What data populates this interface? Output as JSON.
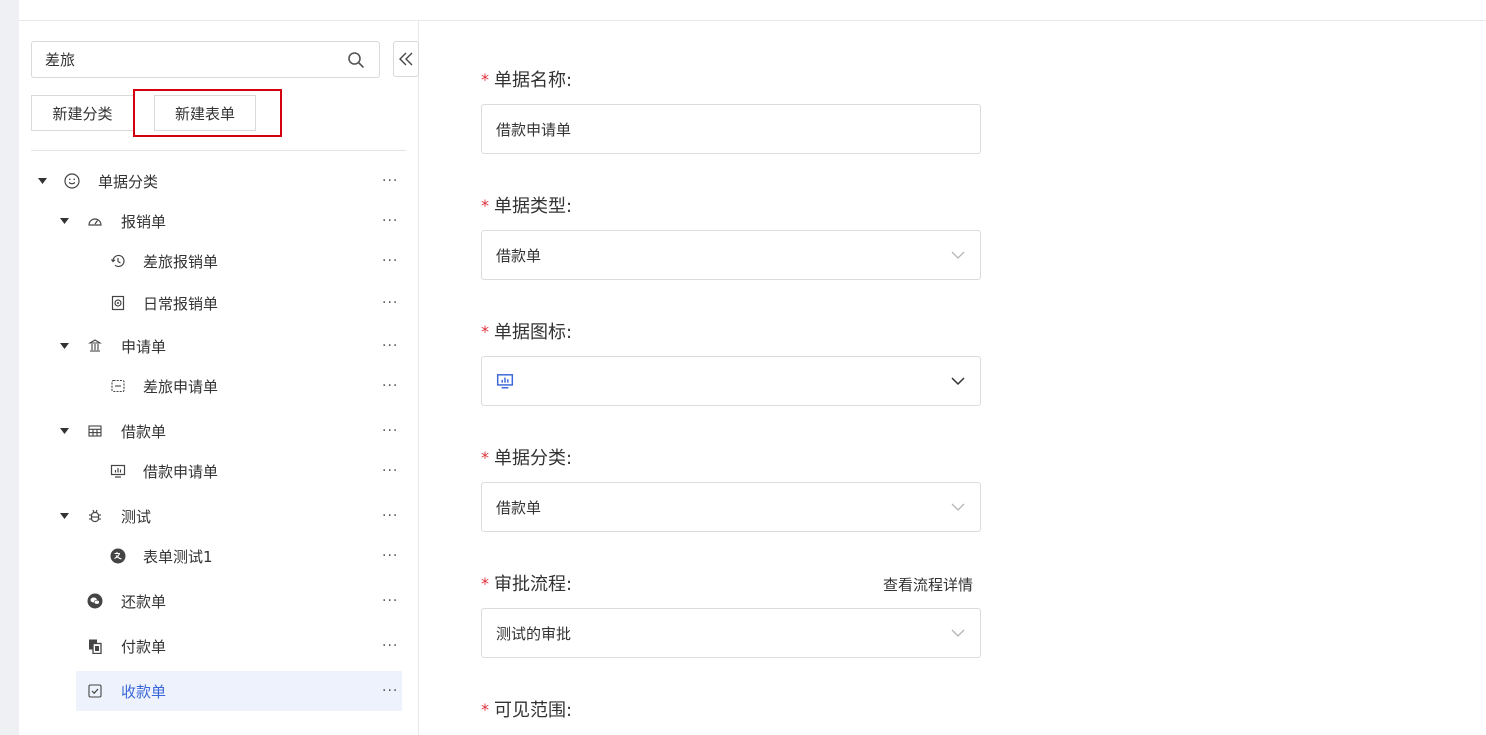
{
  "sidebar": {
    "search_value": "差旅",
    "buttons": {
      "new_category": "新建分类",
      "new_form": "新建表单"
    },
    "tree": [
      {
        "label": "单据分类",
        "more": "···"
      },
      {
        "label": "报销单",
        "more": "···"
      },
      {
        "label": "差旅报销单",
        "more": "···"
      },
      {
        "label": "日常报销单",
        "more": "···"
      },
      {
        "label": "申请单",
        "more": "···"
      },
      {
        "label": "差旅申请单",
        "more": "···"
      },
      {
        "label": "借款单",
        "more": "···"
      },
      {
        "label": "借款申请单",
        "more": "···"
      },
      {
        "label": "测试",
        "more": "···"
      },
      {
        "label": "表单测试1",
        "more": "···"
      },
      {
        "label": "还款单",
        "more": "···"
      },
      {
        "label": "付款单",
        "more": "···"
      },
      {
        "label": "收款单",
        "more": "···"
      }
    ]
  },
  "form": {
    "required_mark": "*",
    "name_label": "单据名称:",
    "name_value": "借款申请单",
    "type_label": "单据类型:",
    "type_value": "借款单",
    "icon_label": "单据图标:",
    "icon_value": "monitor-chart-icon",
    "category_label": "单据分类:",
    "category_value": "借款单",
    "approval_label": "审批流程:",
    "approval_link": "查看流程详情",
    "approval_value": "测试的审批",
    "visibility_label": "可见范围:"
  },
  "colors": {
    "accent": "#3a67d8",
    "required": "#e0303a",
    "highlight_box": "#d4000f",
    "selected_bg": "#eef2fd"
  }
}
